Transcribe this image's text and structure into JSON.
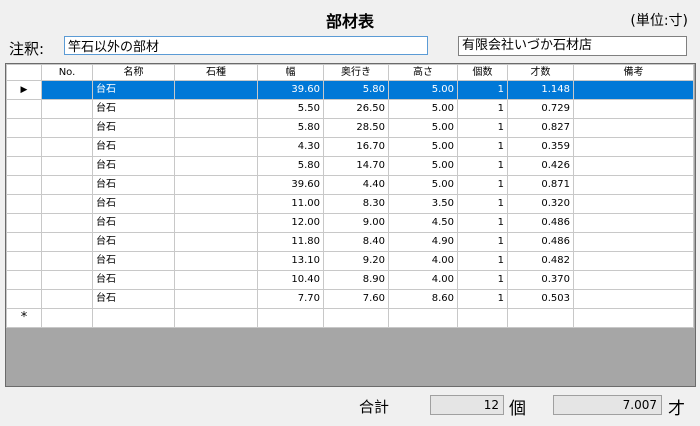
{
  "header": {
    "title": "部材表",
    "unit": "(単位:寸)"
  },
  "note": {
    "label": "注釈:",
    "value": "竿石以外の部材"
  },
  "company": "有限会社いづか石材店",
  "grid": {
    "columns": [
      "No.",
      "名称",
      "石種",
      "幅",
      "奥行き",
      "高さ",
      "個数",
      "才数",
      "備考"
    ],
    "rows": [
      {
        "no": "",
        "name": "台石",
        "stone": "",
        "width": "39.60",
        "depth": "5.80",
        "height": "5.00",
        "count": "1",
        "volume": "1.148",
        "remarks": "",
        "selected": true
      },
      {
        "no": "",
        "name": "台石",
        "stone": "",
        "width": "5.50",
        "depth": "26.50",
        "height": "5.00",
        "count": "1",
        "volume": "0.729",
        "remarks": ""
      },
      {
        "no": "",
        "name": "台石",
        "stone": "",
        "width": "5.80",
        "depth": "28.50",
        "height": "5.00",
        "count": "1",
        "volume": "0.827",
        "remarks": ""
      },
      {
        "no": "",
        "name": "台石",
        "stone": "",
        "width": "4.30",
        "depth": "16.70",
        "height": "5.00",
        "count": "1",
        "volume": "0.359",
        "remarks": ""
      },
      {
        "no": "",
        "name": "台石",
        "stone": "",
        "width": "5.80",
        "depth": "14.70",
        "height": "5.00",
        "count": "1",
        "volume": "0.426",
        "remarks": ""
      },
      {
        "no": "",
        "name": "台石",
        "stone": "",
        "width": "39.60",
        "depth": "4.40",
        "height": "5.00",
        "count": "1",
        "volume": "0.871",
        "remarks": ""
      },
      {
        "no": "",
        "name": "台石",
        "stone": "",
        "width": "11.00",
        "depth": "8.30",
        "height": "3.50",
        "count": "1",
        "volume": "0.320",
        "remarks": ""
      },
      {
        "no": "",
        "name": "台石",
        "stone": "",
        "width": "12.00",
        "depth": "9.00",
        "height": "4.50",
        "count": "1",
        "volume": "0.486",
        "remarks": ""
      },
      {
        "no": "",
        "name": "台石",
        "stone": "",
        "width": "11.80",
        "depth": "8.40",
        "height": "4.90",
        "count": "1",
        "volume": "0.486",
        "remarks": ""
      },
      {
        "no": "",
        "name": "台石",
        "stone": "",
        "width": "13.10",
        "depth": "9.20",
        "height": "4.00",
        "count": "1",
        "volume": "0.482",
        "remarks": ""
      },
      {
        "no": "",
        "name": "台石",
        "stone": "",
        "width": "10.40",
        "depth": "8.90",
        "height": "4.00",
        "count": "1",
        "volume": "0.370",
        "remarks": ""
      },
      {
        "no": "",
        "name": "台石",
        "stone": "",
        "width": "7.70",
        "depth": "7.60",
        "height": "8.60",
        "count": "1",
        "volume": "0.503",
        "remarks": ""
      }
    ],
    "current_row_marker": "▶",
    "new_row_marker": "*"
  },
  "totals": {
    "label": "合計",
    "count": "12",
    "count_unit": "個",
    "volume": "7.007",
    "volume_unit": "才"
  }
}
